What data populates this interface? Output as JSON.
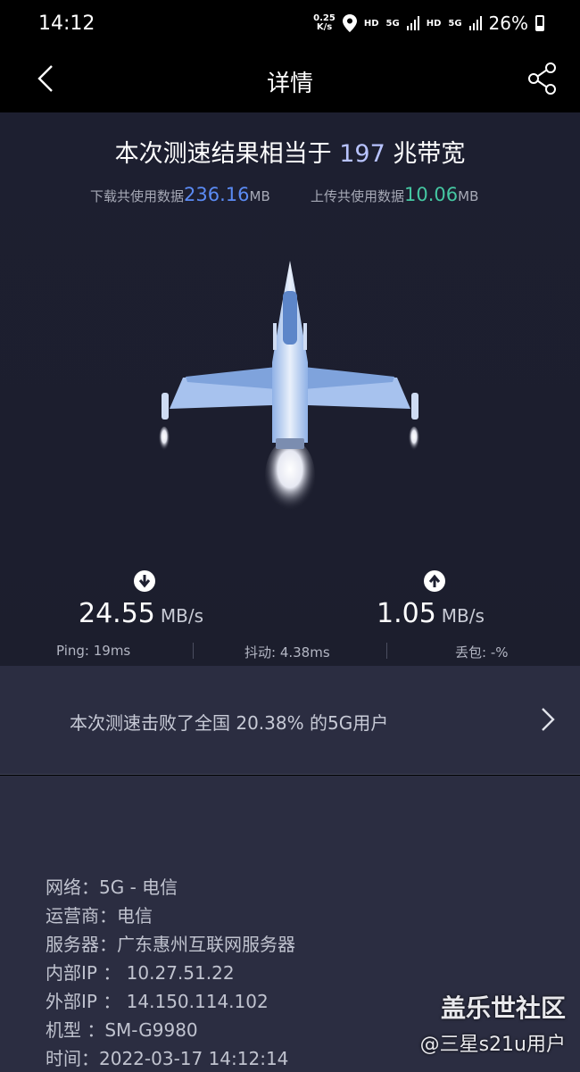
{
  "status_bar": {
    "time": "14:12",
    "net_speed_value": "0.25",
    "net_speed_unit": "K/s",
    "hd1": "HD",
    "sig1": "5G",
    "hd2": "HD",
    "sig2": "5G",
    "battery": "26%"
  },
  "nav": {
    "title": "详情"
  },
  "hero": {
    "headline_prefix": "本次测速结果相当于 ",
    "headline_number": "197",
    "headline_suffix": " 兆带宽",
    "download_usage_label": "下载共使用数据",
    "download_usage_value": "236.16",
    "download_usage_unit": "MB",
    "upload_usage_label": "上传共使用数据",
    "upload_usage_value": "10.06",
    "upload_usage_unit": "MB"
  },
  "speeds": {
    "download_value": "24.55",
    "download_unit": "MB/s",
    "upload_value": "1.05",
    "upload_unit": "MB/s"
  },
  "metrics": {
    "ping": "Ping:  19ms",
    "jitter": "抖动:  4.38ms",
    "loss": "丢包:  -%"
  },
  "rank": {
    "text": "本次测速击败了全国 20.38% 的5G用户"
  },
  "info": {
    "network": "网络：5G - 电信",
    "carrier": "运营商：电信",
    "server": "服务器：广东惠州互联网服务器",
    "internal_ip": "内部IP ：  10.27.51.22",
    "external_ip": "外部IP ：  14.150.114.102",
    "model": "机型 ：SM-G9980",
    "time": "时间：2022-03-17 14:12:14"
  },
  "watermark": {
    "line1": "盖乐世社区",
    "line2": "@三星s21u用户"
  }
}
